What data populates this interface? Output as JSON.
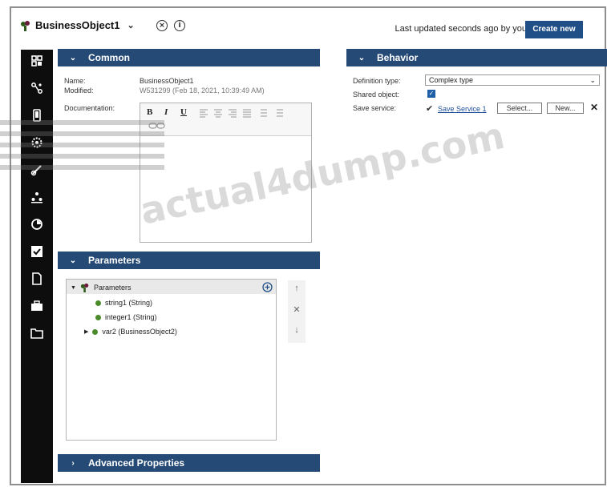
{
  "header": {
    "title": "BusinessObject1",
    "last_updated": "Last updated seconds ago by you",
    "create_new": "Create new"
  },
  "nav": {
    "icons": [
      "overview-icon",
      "flow-icon",
      "mobile-icon",
      "settings-icon",
      "integration-icon",
      "team-icon",
      "performance-icon",
      "check-icon",
      "document-icon",
      "toolkit-icon",
      "folder-icon"
    ]
  },
  "common": {
    "title": "Common",
    "name_label": "Name:",
    "name_value": "BusinessObject1",
    "modified_label": "Modified:",
    "modified_value": "W531299 (Feb 18, 2021, 10:39:49 AM)",
    "documentation_label": "Documentation:"
  },
  "behavior": {
    "title": "Behavior",
    "definition_type_label": "Definition type:",
    "definition_type_value": "Complex type",
    "shared_object_label": "Shared object:",
    "save_service_label": "Save service:",
    "save_service_link": "Save Service 1",
    "select_btn": "Select...",
    "new_btn": "New..."
  },
  "parameters": {
    "title": "Parameters",
    "root": "Parameters",
    "items": [
      "string1 (String)",
      "integer1 (String)",
      "var2 (BusinessObject2)"
    ]
  },
  "advanced": {
    "title": "Advanced Properties"
  },
  "watermark": "actual4dump.com",
  "colors": {
    "section_header": "#254a76",
    "create_button": "#1f4f86",
    "nav_bg": "#0d0d0d"
  }
}
